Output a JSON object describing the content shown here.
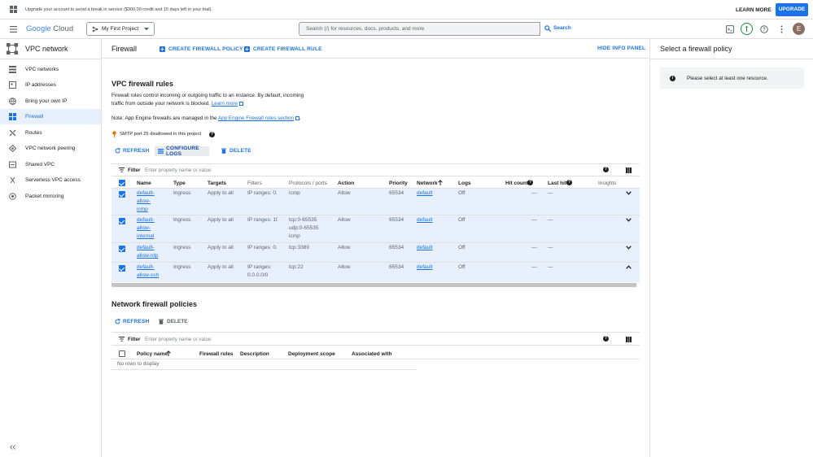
{
  "banner": {
    "text": "Upgrade your account to avoid a break in service ($300.00 credit and 15 days left in your trial).",
    "learn_more": "LEARN MORE",
    "upgrade": "UPGRADE"
  },
  "topbar": {
    "logo_google": "Google",
    "logo_cloud": "Cloud",
    "project": "My First Project",
    "search_placeholder": "Search (/) for resources, docs, products, and more",
    "search_button": "Search",
    "avatar_letter": "E"
  },
  "sidebar": {
    "title": "VPC network",
    "items": [
      {
        "label": "VPC networks",
        "icon": "vpc-networks-icon"
      },
      {
        "label": "IP addresses",
        "icon": "ip-addresses-icon"
      },
      {
        "label": "Bring your own IP",
        "icon": "globe-icon"
      },
      {
        "label": "Firewall",
        "icon": "firewall-icon"
      },
      {
        "label": "Routes",
        "icon": "routes-icon"
      },
      {
        "label": "VPC network peering",
        "icon": "peering-icon"
      },
      {
        "label": "Shared VPC",
        "icon": "shared-vpc-icon"
      },
      {
        "label": "Serverless VPC access",
        "icon": "serverless-icon"
      },
      {
        "label": "Packet mirroring",
        "icon": "packet-mirroring-icon"
      }
    ],
    "active_index": 3
  },
  "page": {
    "title": "Firewall",
    "create_policy": "CREATE FIREWALL POLICY",
    "create_rule": "CREATE FIREWALL RULE",
    "hide_info": "HIDE INFO PANEL"
  },
  "rules_section": {
    "title": "VPC firewall rules",
    "desc1": "Firewall rules control incoming or outgoing traffic to an instance. By default, incoming",
    "desc2": "traffic from outside your network is blocked.",
    "learn_more": "Learn more",
    "note_prefix": "Note: App Engine firewalls are managed in the",
    "note_link": "App Engine Firewall rules section",
    "note_suffix": ".",
    "smtp": "SMTP port 25 disallowed in this project",
    "refresh": "REFRESH",
    "configure_logs": "CONFIGURE LOGS",
    "delete": "DELETE",
    "filter": "Filter",
    "filter_placeholder": "Enter property name or value",
    "columns": [
      "Name",
      "Type",
      "Targets",
      "Filters",
      "Protocols / ports",
      "Action",
      "Priority",
      "Network",
      "Logs",
      "Hit count",
      "Last hit",
      "Insights"
    ],
    "rows": [
      {
        "name": [
          "default-",
          "allow-",
          "icmp"
        ],
        "type": "Ingress",
        "targets": "Apply to all",
        "filters": [
          "IP ranges: 0.("
        ],
        "protocols": [
          "icmp"
        ],
        "action": "Allow",
        "priority": "65534",
        "network": "default",
        "logs": "Off",
        "hit": "—",
        "last": "—"
      },
      {
        "name": [
          "default-",
          "allow-",
          "internal"
        ],
        "type": "Ingress",
        "targets": "Apply to all",
        "filters": [
          "IP ranges: 10"
        ],
        "protocols": [
          "tcp:0-65535",
          "udp:0-65535",
          "icmp"
        ],
        "action": "Allow",
        "priority": "65534",
        "network": "default",
        "logs": "Off",
        "hit": "—",
        "last": "—"
      },
      {
        "name": [
          "default-",
          "allow-rdp"
        ],
        "type": "Ingress",
        "targets": "Apply to all",
        "filters": [
          "IP ranges: 0.("
        ],
        "protocols": [
          "tcp:3389"
        ],
        "action": "Allow",
        "priority": "65534",
        "network": "default",
        "logs": "Off",
        "hit": "—",
        "last": "—"
      },
      {
        "name": [
          "default-",
          "allow-ssh"
        ],
        "type": "Ingress",
        "targets": "Apply to all",
        "filters": [
          "IP ranges:",
          "0.0.0.0/0"
        ],
        "protocols": [
          "tcp:22"
        ],
        "action": "Allow",
        "priority": "65534",
        "network": "default",
        "logs": "Off",
        "hit": "—",
        "last": "—"
      }
    ]
  },
  "policies_section": {
    "title": "Network firewall policies",
    "refresh": "REFRESH",
    "delete": "DELETE",
    "filter": "Filter",
    "filter_placeholder": "Enter property name or value",
    "columns": [
      "Policy name",
      "Firewall rules",
      "Description",
      "Deployment scope",
      "Associated with"
    ],
    "empty": "No rows to display"
  },
  "info_panel": {
    "title": "Select a firewall policy",
    "message": "Please select at least one resource."
  },
  "colors": {
    "accent": "#1a73e8",
    "selected_bg": "#e8f0fe"
  }
}
